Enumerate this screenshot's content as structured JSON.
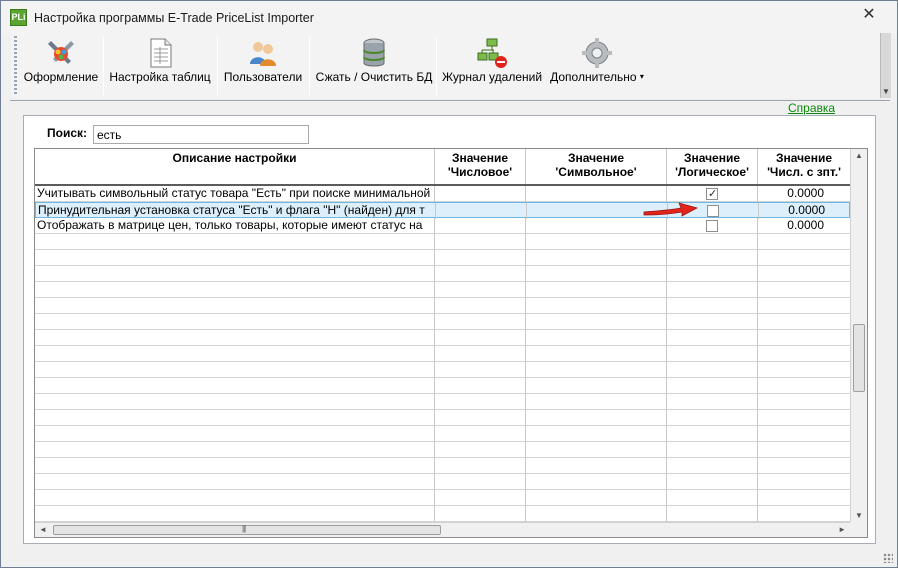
{
  "window": {
    "title": "Настройка программы E-Trade PriceList Importer",
    "icon_text": "PLi",
    "close_glyph": "✕"
  },
  "toolbar": {
    "buttons": [
      {
        "label": "Оформление",
        "icon": "paint-tools-icon"
      },
      {
        "label": "Настройка таблиц",
        "icon": "document-table-icon"
      },
      {
        "label": "Пользователи",
        "icon": "users-icon"
      },
      {
        "label": "Сжать / Очистить БД",
        "icon": "database-icon"
      },
      {
        "label": "Журнал удалений",
        "icon": "network-delete-icon"
      },
      {
        "label": "Дополнительно",
        "icon": "gear-icon",
        "dropdown": "▾"
      }
    ]
  },
  "help_link": "Справка",
  "search": {
    "label": "Поиск:",
    "value": "есть"
  },
  "grid": {
    "headers": [
      {
        "line1": "Описание настройки",
        "line2": ""
      },
      {
        "line1": "Значение",
        "line2": "'Числовое'"
      },
      {
        "line1": "Значение",
        "line2": "'Символьное'"
      },
      {
        "line1": "Значение",
        "line2": "'Логическое'"
      },
      {
        "line1": "Значение",
        "line2": "'Числ. с зпт.'"
      }
    ],
    "rows": [
      {
        "description": "Учитывать символьный статус товара \"Есть\" при поиске минимальной",
        "numeric": "",
        "symbolic": "",
        "logical": true,
        "decimal": "0.0000"
      },
      {
        "description": "Принудительная установка статуса \"Есть\" и флага \"Н\" (найден) для т",
        "numeric": "",
        "symbolic": "",
        "logical": false,
        "decimal": "0.0000"
      },
      {
        "description": "Отображать в матрице цен, только товары, которые имеют статус на",
        "numeric": "",
        "symbolic": "",
        "logical": false,
        "decimal": "0.0000"
      }
    ],
    "selected_row": 1,
    "scroll_glyphs": {
      "up": "▲",
      "down": "▼",
      "left": "◄",
      "right": "►",
      "grip": "|||"
    }
  },
  "colors": {
    "accent_green": "#0a8a0a",
    "selection": "#dceffb",
    "pointer_red": "#e0241c"
  }
}
